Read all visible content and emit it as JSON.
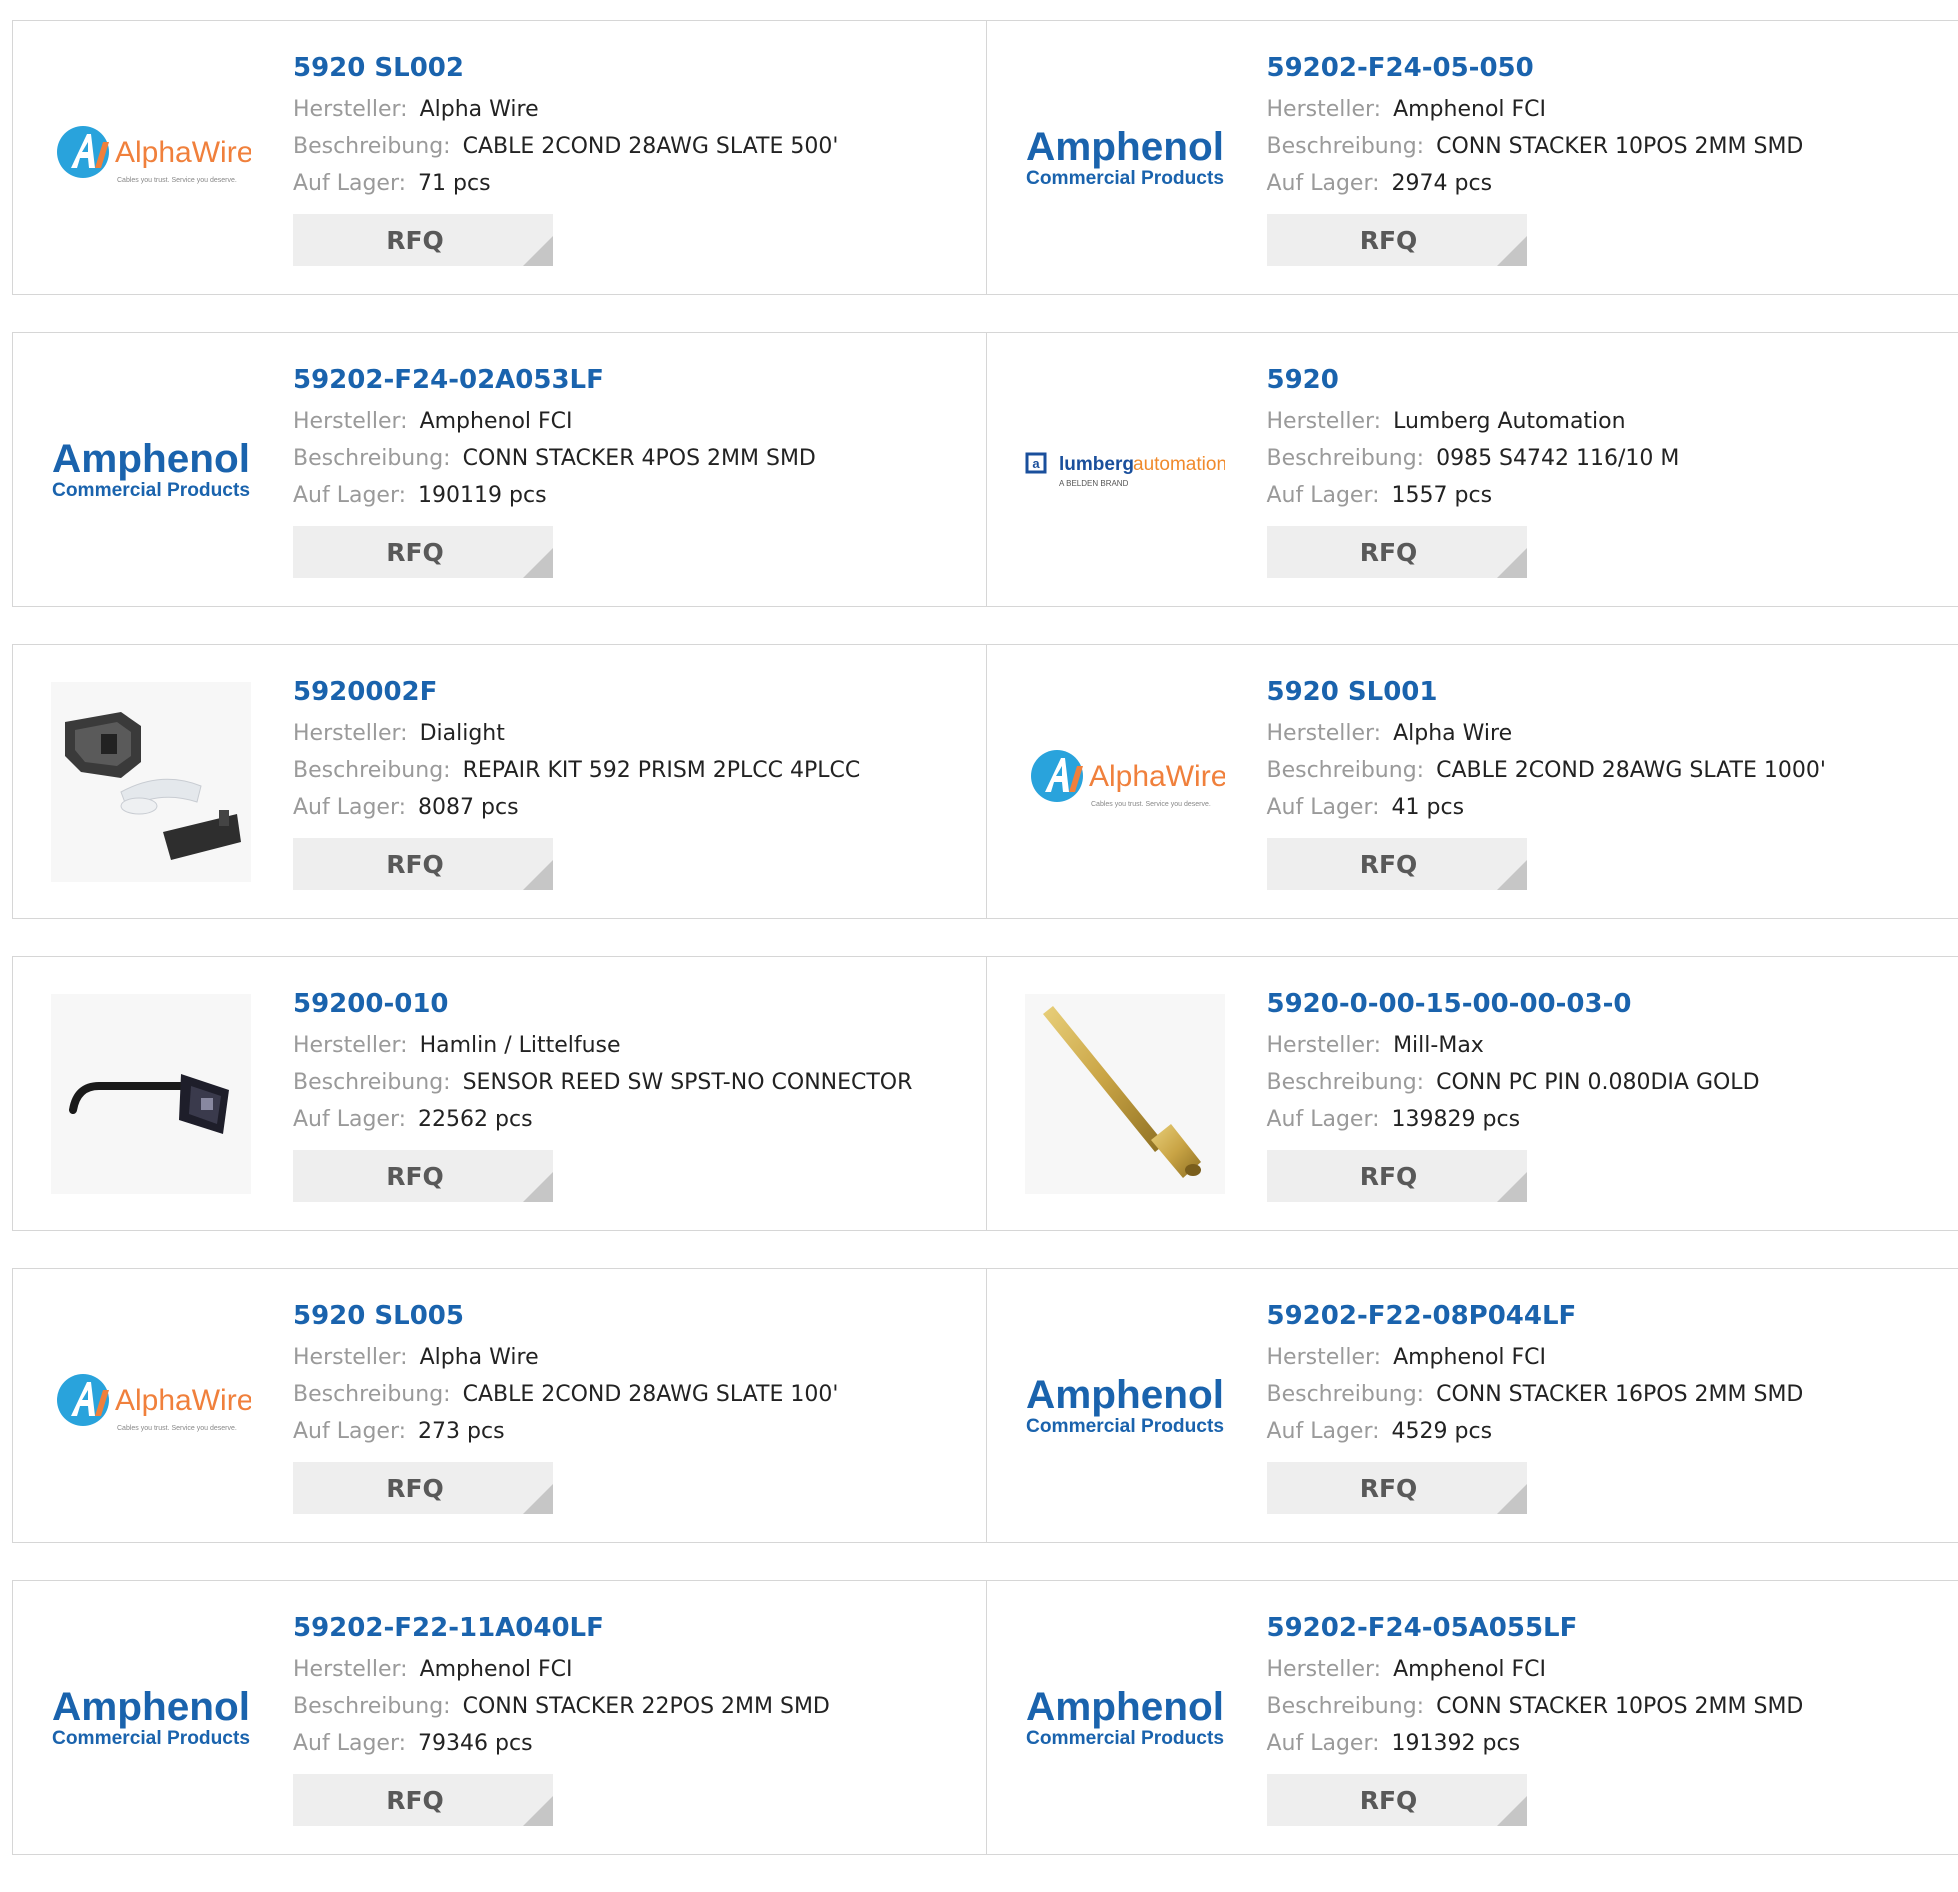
{
  "labels": {
    "manufacturer": "Hersteller:",
    "description": "Beschreibung:",
    "stock": "Auf Lager:",
    "rfq": "RFQ"
  },
  "logos": {
    "alphawire": {
      "name": "AlphaWire",
      "tagline": "Cables you trust. Service you deserve."
    },
    "amphenol": {
      "name": "Amphenol",
      "sub": "Commercial Products"
    },
    "lumberg": {
      "name_a": "lumberg",
      "name_b": "automation",
      "sub": "A BELDEN BRAND"
    }
  },
  "colors": {
    "link": "#1a63ad",
    "label": "#9a9a9a",
    "value": "#222222",
    "button_bg": "#eeeeee",
    "button_text": "#595959",
    "border": "#d6d6d6"
  },
  "products": [
    {
      "part": "5920 SL002",
      "manufacturer": "Alpha Wire",
      "description": "CABLE 2COND 28AWG SLATE 500'",
      "stock": "71 pcs",
      "image": "alphawire-logo"
    },
    {
      "part": "59202-F24-05-050",
      "manufacturer": "Amphenol FCI",
      "description": "CONN STACKER 10POS 2MM SMD",
      "stock": "2974 pcs",
      "image": "amphenol-logo"
    },
    {
      "part": "59202-F24-02A053LF",
      "manufacturer": "Amphenol FCI",
      "description": "CONN STACKER 4POS 2MM SMD",
      "stock": "190119 pcs",
      "image": "amphenol-logo"
    },
    {
      "part": "5920",
      "manufacturer": "Lumberg Automation",
      "description": "0985 S4742 116/10 M",
      "stock": "1557 pcs",
      "image": "lumberg-logo"
    },
    {
      "part": "5920002F",
      "manufacturer": "Dialight",
      "description": "REPAIR KIT 592 PRISM 2PLCC 4PLCC",
      "stock": "8087 pcs",
      "image": "repair-kit-photo"
    },
    {
      "part": "5920 SL001",
      "manufacturer": "Alpha Wire",
      "description": "CABLE 2COND 28AWG SLATE 1000'",
      "stock": "41 pcs",
      "image": "alphawire-logo"
    },
    {
      "part": "59200-010",
      "manufacturer": "Hamlin / Littelfuse",
      "description": "SENSOR REED SW SPST-NO CONNECTOR",
      "stock": "22562 pcs",
      "image": "reed-sensor-photo"
    },
    {
      "part": "5920-0-00-15-00-00-03-0",
      "manufacturer": "Mill-Max",
      "description": "CONN PC PIN 0.080DIA GOLD",
      "stock": "139829 pcs",
      "image": "gold-pin-photo"
    },
    {
      "part": "5920 SL005",
      "manufacturer": "Alpha Wire",
      "description": "CABLE 2COND 28AWG SLATE 100'",
      "stock": "273 pcs",
      "image": "alphawire-logo"
    },
    {
      "part": "59202-F22-08P044LF",
      "manufacturer": "Amphenol FCI",
      "description": "CONN STACKER 16POS 2MM SMD",
      "stock": "4529 pcs",
      "image": "amphenol-logo"
    },
    {
      "part": "59202-F22-11A040LF",
      "manufacturer": "Amphenol FCI",
      "description": "CONN STACKER 22POS 2MM SMD",
      "stock": "79346 pcs",
      "image": "amphenol-logo"
    },
    {
      "part": "59202-F24-05A055LF",
      "manufacturer": "Amphenol FCI",
      "description": "CONN STACKER 10POS 2MM SMD",
      "stock": "191392 pcs",
      "image": "amphenol-logo"
    }
  ]
}
